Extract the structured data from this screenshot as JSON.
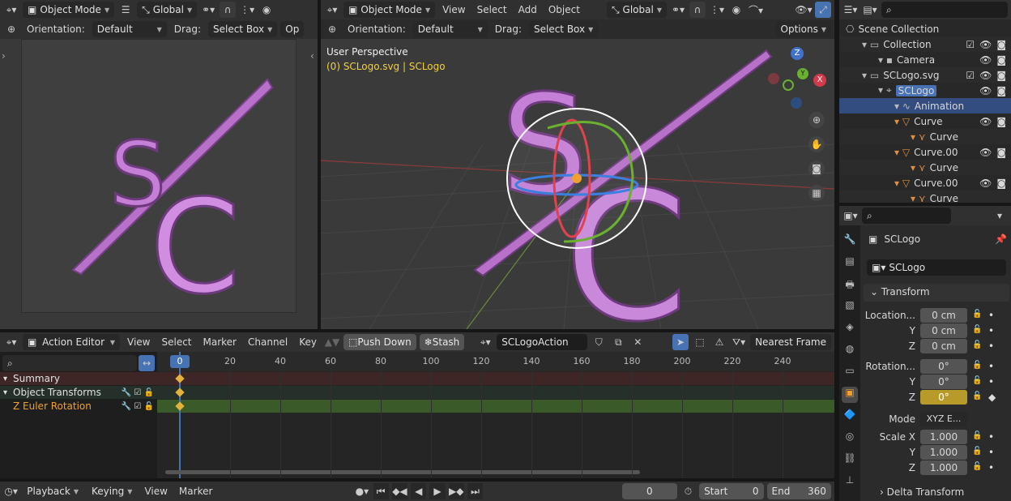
{
  "colors": {
    "accent": "#4772b3",
    "keyframe": "#e3b23c",
    "selected_obj": "#f0a030",
    "logo": "#c57fd6",
    "grid": "#3c3c3c"
  },
  "left_view": {
    "mode": "Object Mode",
    "transform": "Global",
    "orientation_label": "Orientation:",
    "orientation": "Default",
    "drag_label": "Drag:",
    "drag": "Select Box",
    "op_clip": "Op",
    "icons": [
      "editor-type-icon",
      "object-mode-icon",
      "menu-icon",
      "transform-icon",
      "link-icon",
      "magnet-icon",
      "snap-icon",
      "proportional-icon"
    ]
  },
  "main_view": {
    "mode": "Object Mode",
    "menus": [
      "View",
      "Select",
      "Add",
      "Object"
    ],
    "transform": "Global",
    "orientation_label": "Orientation:",
    "orientation": "Default",
    "drag_label": "Drag:",
    "drag": "Select Box",
    "options": "Options",
    "overlay_title": "User Perspective",
    "overlay_sub": "(0) SCLogo.svg | SCLogo",
    "gizmo": {
      "x": "X",
      "y": "Y",
      "z": "Z"
    },
    "nav_icons": [
      "zoom-icon",
      "hand-icon",
      "camera-icon",
      "grid-icon"
    ]
  },
  "outliner": {
    "search_placeholder": "",
    "items": [
      {
        "label": "Scene Collection",
        "depth": 0,
        "icon": "scene-collection-icon"
      },
      {
        "label": "Collection",
        "depth": 1,
        "icon": "collection-icon",
        "checks": true
      },
      {
        "label": "Camera",
        "depth": 2,
        "icon": "camera-object-icon",
        "checks": false
      },
      {
        "label": "SCLogo.svg",
        "depth": 1,
        "icon": "collection-icon",
        "checks": true
      },
      {
        "label": "SCLogo",
        "depth": 2,
        "icon": "empty-icon",
        "active": true
      },
      {
        "label": "Animation",
        "depth": 3,
        "icon": "animation-icon",
        "selected": true
      },
      {
        "label": "Curve",
        "depth": 3,
        "icon": "curve-icon"
      },
      {
        "label": "Curve",
        "depth": 4,
        "icon": "curve-data-icon"
      },
      {
        "label": "Curve.00",
        "depth": 3,
        "icon": "curve-icon"
      },
      {
        "label": "Curve",
        "depth": 4,
        "icon": "curve-data-icon"
      },
      {
        "label": "Curve.00",
        "depth": 3,
        "icon": "curve-icon"
      },
      {
        "label": "Curve",
        "depth": 4,
        "icon": "curve-data-icon"
      }
    ]
  },
  "properties": {
    "object_name": "SCLogo",
    "data_name": "SCLogo",
    "section": "Transform",
    "location_label": "Location...",
    "loc": [
      "0 cm",
      "0 cm",
      "0 cm"
    ],
    "rotation_label": "Rotation...",
    "rot": [
      "0°",
      "0°",
      "0°"
    ],
    "mode_label": "Mode",
    "mode_value": "XYZ E...",
    "scale_label": "Scale X",
    "scale": [
      "1.000",
      "1.000",
      "1.000"
    ],
    "axis_y": "Y",
    "axis_z": "Z",
    "delta": "Delta Transform",
    "tab_icons": [
      "tool-icon",
      "render-icon",
      "output-icon",
      "view-layer-icon",
      "scene-icon",
      "world-icon",
      "collection-tab-icon",
      "object-icon",
      "modifier-icon",
      "physics-icon",
      "constraint-icon",
      "data-icon"
    ]
  },
  "action_editor": {
    "mode": "Action Editor",
    "menus": [
      "View",
      "Select",
      "Marker",
      "Channel",
      "Key"
    ],
    "push_down": "Push Down",
    "stash": "Stash",
    "action_name": "SCLogoAction",
    "snap": "Nearest Frame",
    "current_frame": "0",
    "ruler": [
      "20",
      "40",
      "60",
      "80",
      "100",
      "120",
      "140",
      "160",
      "180",
      "200",
      "220",
      "240"
    ],
    "ruler_frames": [
      20,
      40,
      60,
      80,
      100,
      120,
      140,
      160,
      180,
      200,
      220,
      240
    ],
    "channels": [
      {
        "label": "Summary",
        "type": "summary"
      },
      {
        "label": "Object Transforms",
        "type": "group"
      },
      {
        "label": "Z Euler Rotation",
        "type": "fcurve"
      }
    ]
  },
  "timeline": {
    "menus": [
      "Playback",
      "Keying",
      "View",
      "Marker"
    ],
    "frame": "0",
    "start_label": "Start",
    "start": "0",
    "end_label": "End",
    "end": "360"
  }
}
